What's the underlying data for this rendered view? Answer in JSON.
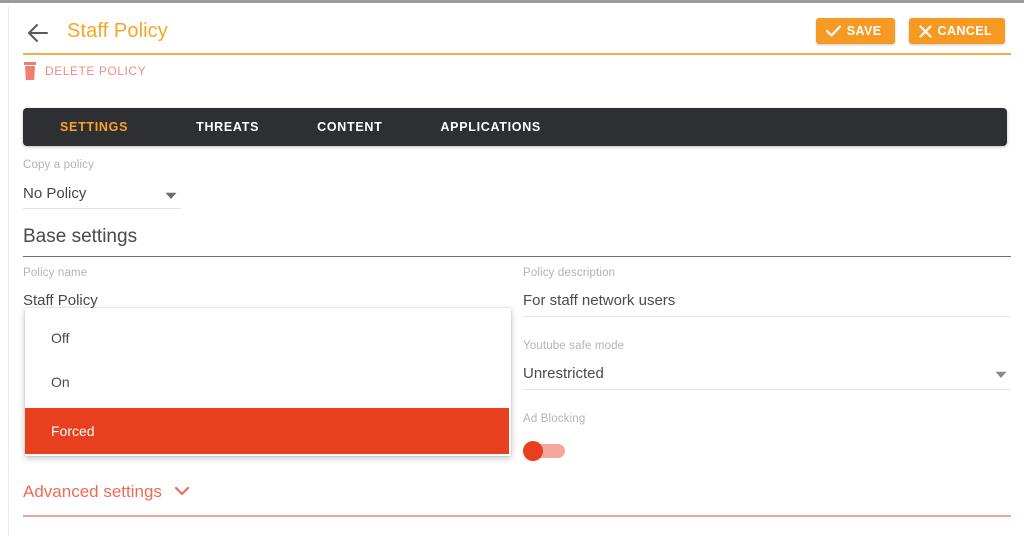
{
  "header": {
    "back_icon": "arrow-left-icon",
    "title": "Staff Policy",
    "save_label": "SAVE",
    "save_icon": "check-icon",
    "cancel_label": "CANCEL",
    "cancel_icon": "close-icon",
    "accent_color": "#f79a24",
    "title_color": "#f5a623"
  },
  "delete": {
    "label": "DELETE POLICY",
    "icon": "trash-icon",
    "color": "#f28a7c"
  },
  "tabs": [
    {
      "label": "SETTINGS",
      "active": true
    },
    {
      "label": "THREATS",
      "active": false
    },
    {
      "label": "CONTENT",
      "active": false
    },
    {
      "label": "APPLICATIONS",
      "active": false
    }
  ],
  "copy_policy": {
    "label": "Copy a policy",
    "value": "No Policy",
    "caret_icon": "chevron-down-icon"
  },
  "base_settings": {
    "title": "Base settings",
    "policy_name": {
      "label": "Policy name",
      "value": "Staff Policy"
    },
    "policy_description": {
      "label": "Policy description",
      "value": "For staff network users"
    },
    "youtube_safe_mode": {
      "label": "Youtube safe mode",
      "value": "Unrestricted",
      "caret_icon": "chevron-down-icon"
    },
    "ad_blocking": {
      "label": "Ad Blocking",
      "state": "off",
      "knob_color": "#e8401f",
      "track_color": "#f5a79b"
    }
  },
  "dropdown": {
    "options": [
      {
        "label": "Off",
        "selected": false
      },
      {
        "label": "On",
        "selected": false
      },
      {
        "label": "Forced",
        "selected": true
      }
    ],
    "highlight_color": "#e8401f"
  },
  "advanced": {
    "label": "Advanced settings",
    "caret_icon": "chevron-down-icon",
    "color": "#ee6a55"
  }
}
